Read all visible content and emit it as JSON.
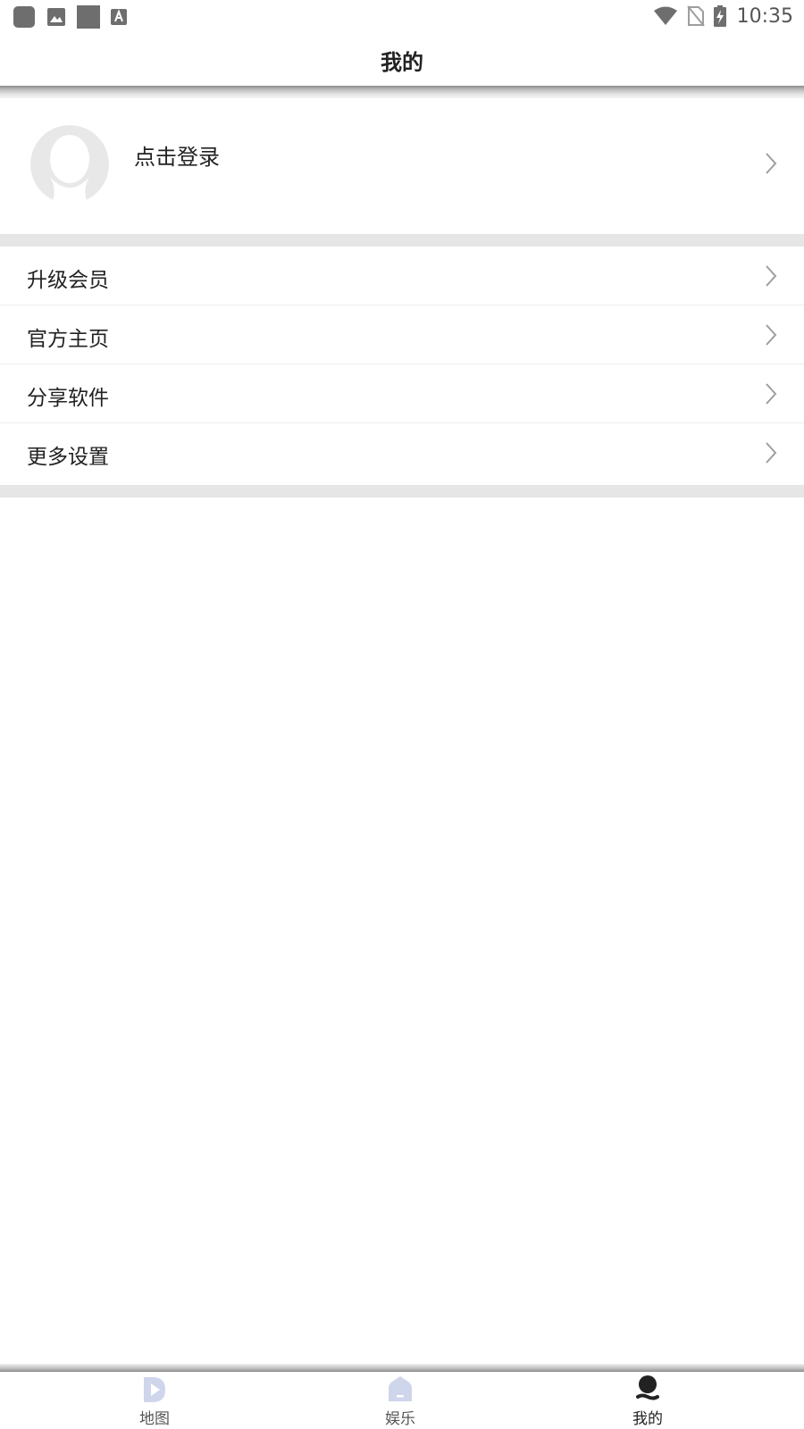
{
  "status_bar": {
    "time": "10:35",
    "left_icons": [
      "app-icon",
      "image-icon",
      "square-icon",
      "font-icon"
    ],
    "right_icons": [
      "wifi-icon",
      "no-sim-icon",
      "battery-charging-icon"
    ]
  },
  "header": {
    "title": "我的"
  },
  "profile": {
    "login_label": "点击登录"
  },
  "menu": {
    "items": [
      {
        "label": "升级会员"
      },
      {
        "label": "官方主页"
      },
      {
        "label": "分享软件"
      },
      {
        "label": "更多设置"
      }
    ]
  },
  "bottom_nav": {
    "items": [
      {
        "label": "地图",
        "active": false
      },
      {
        "label": "娱乐",
        "active": false
      },
      {
        "label": "我的",
        "active": true
      }
    ]
  },
  "colors": {
    "nav_inactive_icon": "#cfd5ea",
    "nav_active_icon": "#222222",
    "section_gap": "#e6e6e6",
    "chevron": "#9e9e9e",
    "avatar": "#e8e8e8"
  }
}
